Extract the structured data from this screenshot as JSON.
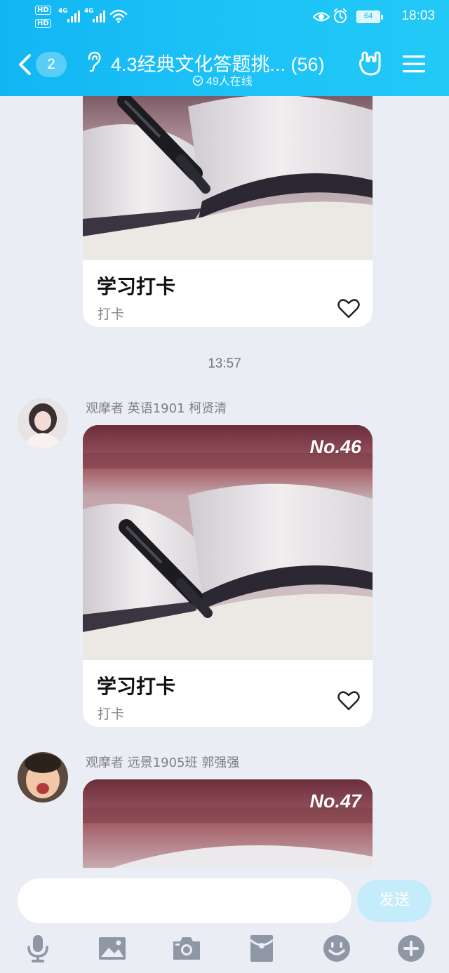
{
  "status_bar": {
    "time": "18:03",
    "battery": "64",
    "network_type_1": "4G",
    "network_type_2": "4G",
    "hd_label": "HD"
  },
  "nav": {
    "unread_count": "2",
    "title": "4.3经典文化答题挑... (56)",
    "online": "49人在线"
  },
  "messages": [
    {
      "type": "card",
      "title": "学习打卡",
      "subtitle": "打卡"
    },
    {
      "type": "timestamp",
      "time": "13:57"
    },
    {
      "type": "card",
      "sender": "观摩者  英语1901 柯贤清",
      "number": "No.46",
      "title": "学习打卡",
      "subtitle": "打卡"
    },
    {
      "type": "card",
      "sender": "观摩者  远景1905班 郭强强",
      "number": "No.47"
    }
  ],
  "input": {
    "value": "",
    "send_label": "发送"
  },
  "toolbar": {
    "icons": [
      "microphone-icon",
      "image-icon",
      "camera-icon",
      "red-packet-icon",
      "emoji-icon",
      "plus-icon"
    ]
  },
  "colors": {
    "header": "#1ec4f7",
    "background": "#eaedf4",
    "send_button": "#c4ecfb",
    "toolbar_icon": "#8f97a7"
  }
}
